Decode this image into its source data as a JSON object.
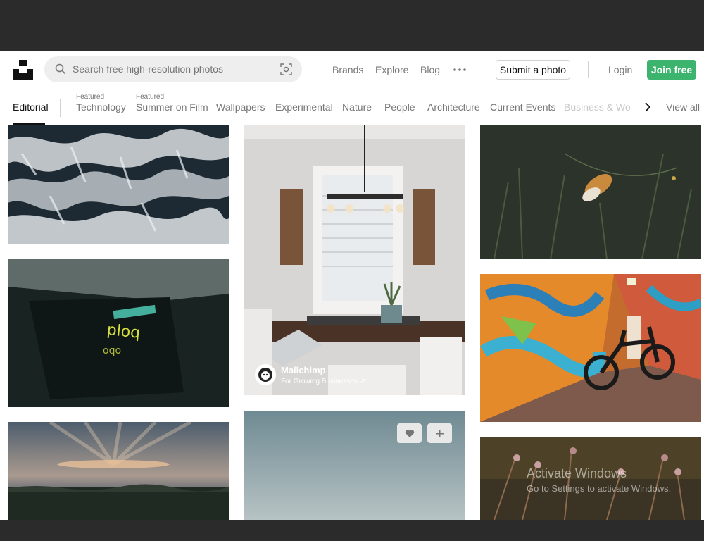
{
  "header": {
    "search_placeholder": "Search free high-resolution photos",
    "nav": [
      "Brands",
      "Explore",
      "Blog"
    ],
    "submit_label": "Submit a photo",
    "login_label": "Login",
    "join_label": "Join free",
    "accent_color": "#3cb46e"
  },
  "categories": {
    "active": "Editorial",
    "featured_tag": "Featured",
    "featured": [
      "Technology",
      "Summer on Film"
    ],
    "items": [
      "Wallpapers",
      "Experimental",
      "Nature",
      "People",
      "Architecture",
      "Current Events"
    ],
    "faded": "Business & Work",
    "view_all": "View all"
  },
  "ad": {
    "brand": "Mailchimp",
    "tagline": "For Growing Businesses ↗"
  },
  "watermark": {
    "title": "Activate Windows",
    "subtitle": "Go to Settings to activate Windows."
  },
  "icons": {
    "logo": "unsplash-logo",
    "search": "search-icon",
    "visual_search": "visual-search-icon",
    "more": "more-dots-icon",
    "next": "chevron-right-icon",
    "like": "heart-icon",
    "collect": "plus-icon"
  }
}
